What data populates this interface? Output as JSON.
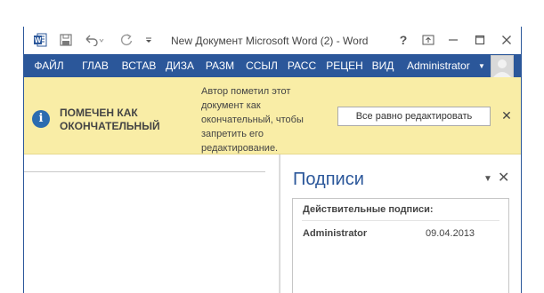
{
  "window": {
    "title": "New Документ Microsoft Word (2) - Word",
    "app_icon": "word-icon",
    "colors": {
      "accent": "#2b579a",
      "message_bar": "#f9eda6",
      "pane_title": "#2b579a"
    }
  },
  "quick_access": {
    "save_icon": "save-icon",
    "undo_icon": "undo-icon",
    "redo_icon": "redo-icon",
    "customize_icon": "customize-qat-icon"
  },
  "title_controls": {
    "help": "?",
    "ribbon_display_icon": "ribbon-display-options-icon",
    "minimize_icon": "minimize-icon",
    "maximize_icon": "maximize-icon",
    "close_icon": "close-icon"
  },
  "ribbon": {
    "tabs": [
      {
        "label": "ФАЙЛ"
      },
      {
        "label": "ГЛАВ"
      },
      {
        "label": "ВСТАВ"
      },
      {
        "label": "ДИЗА"
      },
      {
        "label": "РАЗМ"
      },
      {
        "label": "ССЫЛ"
      },
      {
        "label": "РАСС"
      },
      {
        "label": "РЕЦЕН"
      },
      {
        "label": "ВИД"
      }
    ],
    "user_name": "Administrator",
    "avatar_icon": "user-avatar-icon"
  },
  "message_bar": {
    "title": "ПОМЕЧЕН КАК ОКОНЧАТЕЛЬНЫЙ",
    "text": "Автор пометил этот документ как окончательный, чтобы запретить его редактирование.",
    "button_label": "Все равно редактировать",
    "info_icon": "info-icon",
    "close_label": "✕"
  },
  "signatures_pane": {
    "title": "Подписи",
    "valid_header": "Действительные подписи:",
    "signatures": [
      {
        "name": "Administrator",
        "date": "09.04.2013"
      }
    ]
  }
}
